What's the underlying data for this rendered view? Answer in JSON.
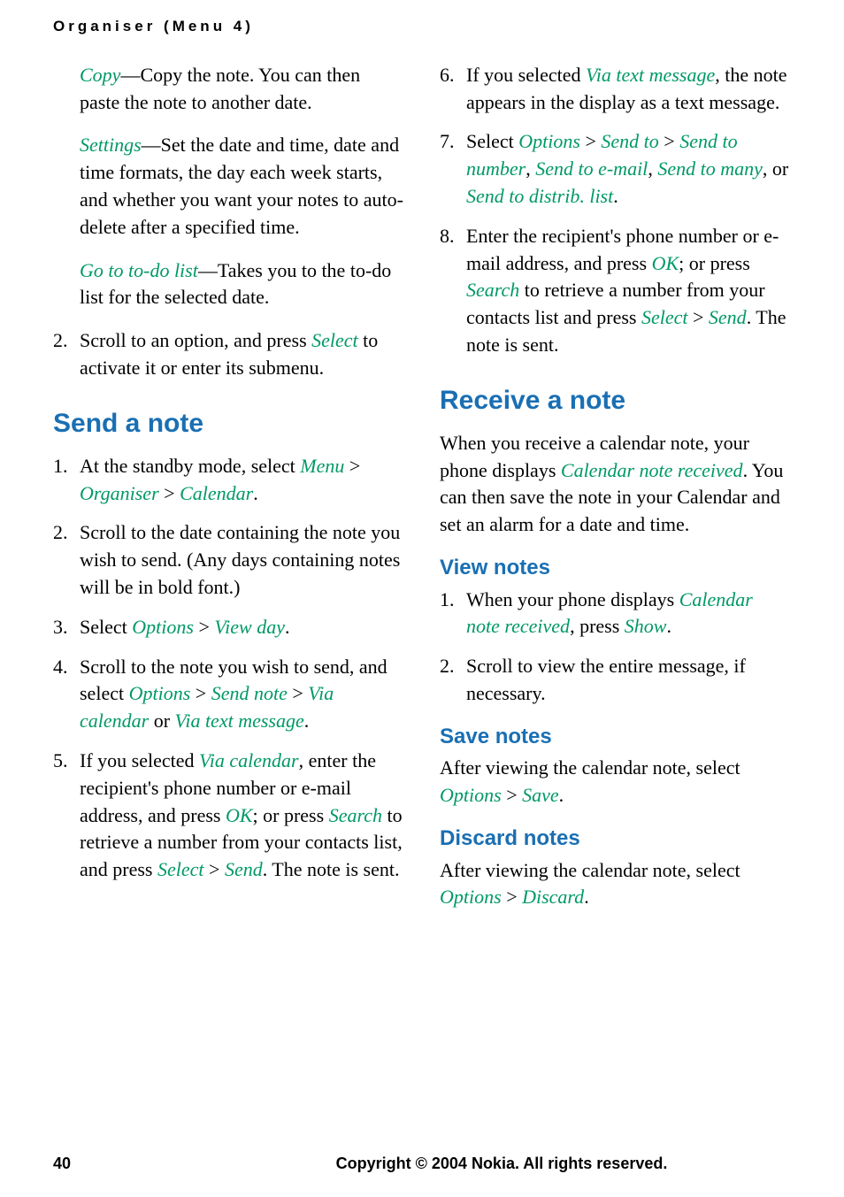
{
  "header": "Organiser (Menu 4)",
  "left": {
    "copy": {
      "hi": "Copy",
      "rest": "—Copy the note. You can then paste the note to another date."
    },
    "settings": {
      "hi": "Settings",
      "rest": "—Set the date and time, date and time formats, the day each week starts, and whether you want your notes to auto-delete after a specified time."
    },
    "goto": {
      "hi": "Go to to-do list",
      "rest": "—Takes you to the to-do list for the selected date."
    },
    "l2": {
      "num": "2.",
      "a": "Scroll to an option, and press ",
      "hi": "Select",
      "b": " to activate it or enter its submenu."
    },
    "send_title": "Send a note",
    "s1": {
      "num": "1.",
      "a": "At the standby mode, select ",
      "menu": "Menu",
      "gt1": " > ",
      "org": "Organiser",
      "gt2": " > ",
      "cal": "Calendar",
      "dot": "."
    },
    "s2": {
      "num": "2.",
      "txt": "Scroll to the date containing the note you wish to send. (Any days containing notes will be in bold font.)"
    },
    "s3": {
      "num": "3.",
      "a": "Select ",
      "opt": "Options",
      "gt": " > ",
      "vd": "View day",
      "dot": "."
    },
    "s4": {
      "num": "4.",
      "a": "Scroll to the note you wish to send, and select ",
      "opt": "Options",
      "gt1": " > ",
      "sn": "Send note",
      "gt2": " > ",
      "vc": "Via calendar",
      "or": " or ",
      "vtm": "Via text message",
      "dot": "."
    },
    "s5": {
      "num": "5.",
      "a": "If you selected ",
      "vc": "Via calendar",
      "b": ", enter the recipient's phone number or e-mail address, and press ",
      "ok": "OK",
      "c": "; or press ",
      "search": "Search",
      "d": " to retrieve a number from your contacts list, and press ",
      "select": "Select",
      "gt": " > ",
      "send": "Send",
      "e": ". The note is sent."
    }
  },
  "right": {
    "r6": {
      "num": "6.",
      "a": "If you selected ",
      "vtm": "Via text message",
      "b": ", the note appears in the display as a text message."
    },
    "r7": {
      "num": "7.",
      "a": "Select ",
      "opt": "Options",
      "gt1": " > ",
      "st": "Send to",
      "gt2": " > ",
      "stn": "Send to number",
      "c1": ", ",
      "ste": "Send to e-mail",
      "c2": ", ",
      "stm": "Send to many",
      "or": ", or ",
      "std": "Send to distrib. list",
      "dot": "."
    },
    "r8": {
      "num": "8.",
      "a": "Enter the recipient's phone number or e-mail address, and press ",
      "ok": "OK",
      "b": "; or press ",
      "search": "Search",
      "c": " to retrieve a number from your contacts list and press ",
      "select": "Select",
      "gt": " > ",
      "send": "Send",
      "d": ". The note is sent."
    },
    "recv_title": "Receive a note",
    "recv_para": {
      "a": "When you receive a calendar note, your phone displays ",
      "cnr": "Calendar note received",
      "b": ". You can then save the note in your Calendar and set an alarm for a date and time."
    },
    "view_title": "View notes",
    "v1": {
      "num": "1.",
      "a": "When your phone displays ",
      "cnr": "Calendar note received",
      "b": ", press ",
      "show": "Show",
      "dot": "."
    },
    "v2": {
      "num": "2.",
      "txt": "Scroll to view the entire message, if necessary."
    },
    "save_title": "Save notes",
    "save_para": {
      "a": "After viewing the calendar note, select ",
      "opt": "Options",
      "gt": " > ",
      "save": "Save",
      "dot": "."
    },
    "discard_title": "Discard notes",
    "discard_para": {
      "a": "After viewing the calendar note, select ",
      "opt": "Options",
      "gt": " > ",
      "discard": "Discard",
      "dot": "."
    }
  },
  "footer": {
    "page": "40",
    "copyright": "Copyright © 2004 Nokia. All rights reserved."
  }
}
